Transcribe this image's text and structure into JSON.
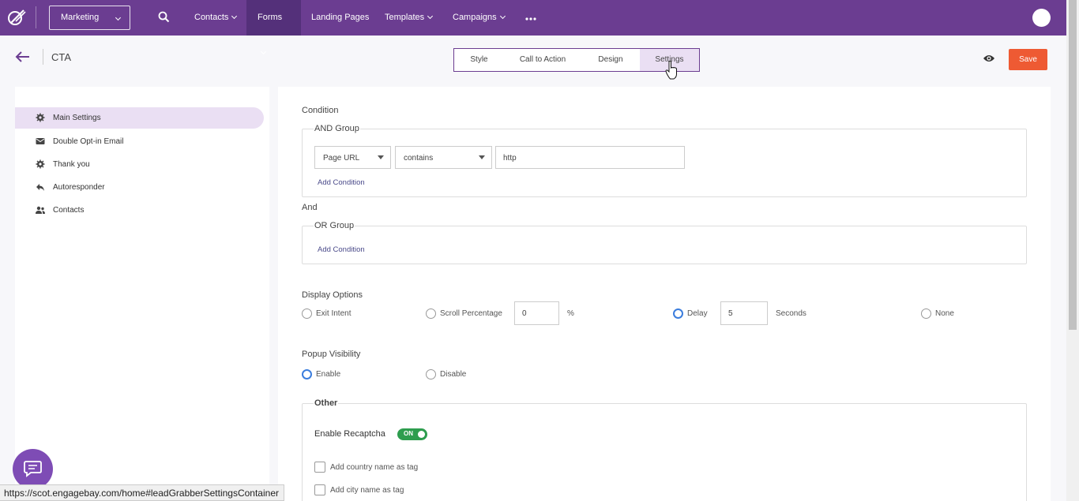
{
  "nav": {
    "app_switcher": "Marketing",
    "items": [
      {
        "label": "Contacts",
        "dropdown": true
      },
      {
        "label": "Forms",
        "dropdown": true,
        "active": true
      },
      {
        "label": "Landing Pages",
        "dropdown": false
      },
      {
        "label": "Templates",
        "dropdown": true
      },
      {
        "label": "Campaigns",
        "dropdown": true
      }
    ],
    "more_icon": "more-horizontal-icon",
    "accent_color": "#6b3d91"
  },
  "header": {
    "title": "CTA",
    "tabs": [
      {
        "label": "Style"
      },
      {
        "label": "Call to Action"
      },
      {
        "label": "Design"
      },
      {
        "label": "Settings",
        "active": true
      }
    ],
    "save_label": "Save",
    "save_color": "#ee5a33"
  },
  "sidebar": {
    "items": [
      {
        "label": "Main Settings",
        "icon": "gear-icon",
        "active": true
      },
      {
        "label": "Double Opt-in Email",
        "icon": "envelope-icon"
      },
      {
        "label": "Thank you",
        "icon": "gear-icon"
      },
      {
        "label": "Autoresponder",
        "icon": "reply-icon"
      },
      {
        "label": "Contacts",
        "icon": "users-icon"
      }
    ]
  },
  "main": {
    "condition_label": "Condition",
    "and_group": {
      "legend": "AND Group",
      "field_select": "Page URL",
      "operator_select": "contains",
      "value": "http",
      "add_condition": "Add Condition"
    },
    "and_label": "And",
    "or_group": {
      "legend": "OR Group",
      "add_condition": "Add Condition"
    },
    "display_options": {
      "label": "Display Options",
      "exit_intent": "Exit Intent",
      "scroll_percentage": "Scroll Percentage",
      "scroll_value": "0",
      "percent_sign": "%",
      "delay": "Delay",
      "delay_value": "5",
      "seconds": "Seconds",
      "none": "None",
      "selected": "Delay"
    },
    "popup_visibility": {
      "label": "Popup Visibility",
      "enable": "Enable",
      "disable": "Disable",
      "selected": "Enable"
    },
    "other": {
      "legend": "Other",
      "recaptcha_label": "Enable Recaptcha",
      "recaptcha_toggle": "ON",
      "country_tag": "Add country name as tag",
      "city_tag": "Add city name as tag"
    }
  },
  "status_bar": {
    "url": "https://scot.engagebay.com/home#leadGrabberSettingsContainer"
  }
}
